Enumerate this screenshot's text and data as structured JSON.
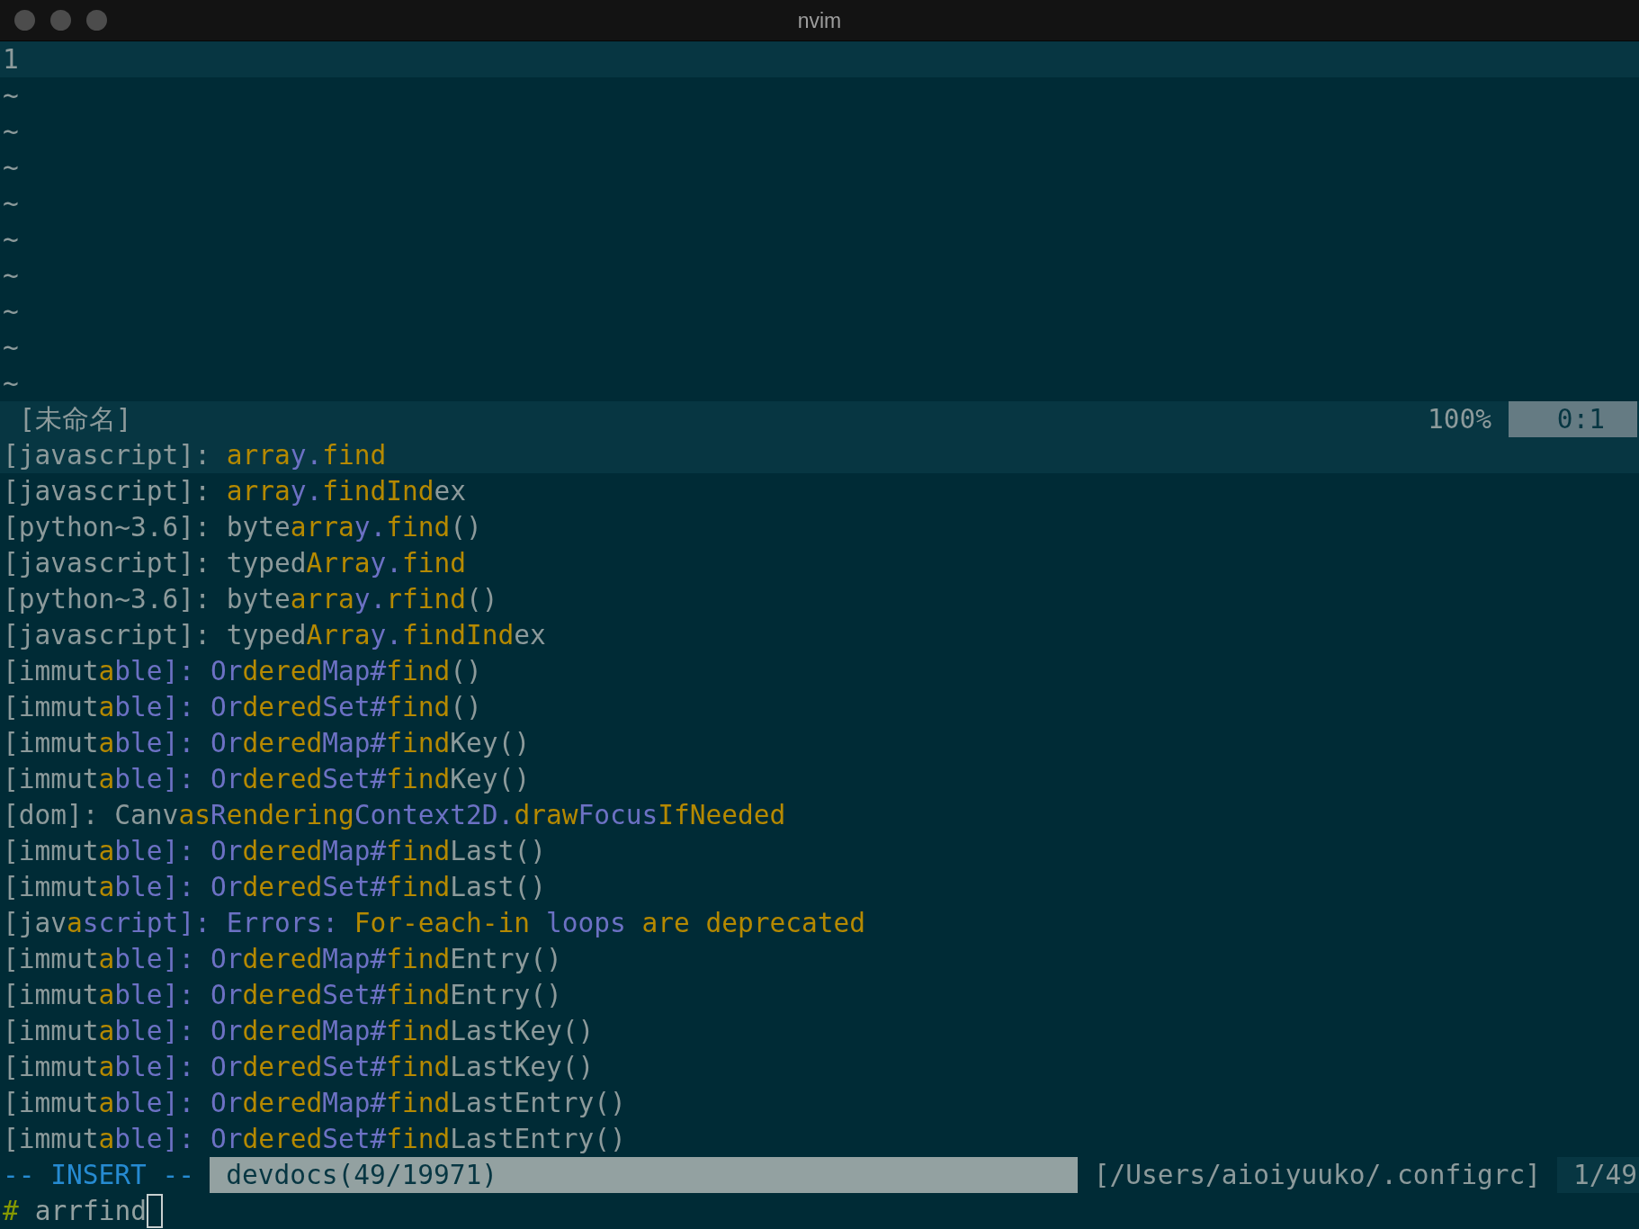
{
  "window": {
    "title": "nvim"
  },
  "editor": {
    "lines": [
      {
        "number": "1",
        "current": true
      }
    ],
    "filler_lines": [
      "~",
      "~",
      "~",
      "~",
      "~",
      "~",
      "~",
      "~",
      "~"
    ]
  },
  "status_line": {
    "file_name": "[未命名]",
    "percent": "100%",
    "position": "0:1"
  },
  "results": [
    {
      "selected": true,
      "segments": [
        {
          "text": "[javascript]: ",
          "kind": "plain"
        },
        {
          "text": "arra",
          "kind": "match"
        },
        {
          "text": "y.",
          "kind": "accent"
        },
        {
          "text": "find",
          "kind": "match"
        }
      ]
    },
    {
      "selected": false,
      "segments": [
        {
          "text": "[javascript]: ",
          "kind": "plain"
        },
        {
          "text": "arra",
          "kind": "match"
        },
        {
          "text": "y.",
          "kind": "accent"
        },
        {
          "text": "findInd",
          "kind": "match"
        },
        {
          "text": "ex",
          "kind": "plain"
        }
      ]
    },
    {
      "selected": false,
      "segments": [
        {
          "text": "[python~3.6]: byte",
          "kind": "plain"
        },
        {
          "text": "arra",
          "kind": "match"
        },
        {
          "text": "y.",
          "kind": "accent"
        },
        {
          "text": "find",
          "kind": "match"
        },
        {
          "text": "()",
          "kind": "plain"
        }
      ]
    },
    {
      "selected": false,
      "segments": [
        {
          "text": "[javascript]: typed",
          "kind": "plain"
        },
        {
          "text": "Arra",
          "kind": "match"
        },
        {
          "text": "y.",
          "kind": "accent"
        },
        {
          "text": "find",
          "kind": "match"
        }
      ]
    },
    {
      "selected": false,
      "segments": [
        {
          "text": "[python~3.6]: byte",
          "kind": "plain"
        },
        {
          "text": "arra",
          "kind": "match"
        },
        {
          "text": "y.",
          "kind": "accent"
        },
        {
          "text": "rfind",
          "kind": "match"
        },
        {
          "text": "()",
          "kind": "plain"
        }
      ]
    },
    {
      "selected": false,
      "segments": [
        {
          "text": "[javascript]: typed",
          "kind": "plain"
        },
        {
          "text": "Arra",
          "kind": "match"
        },
        {
          "text": "y.",
          "kind": "accent"
        },
        {
          "text": "findInd",
          "kind": "match"
        },
        {
          "text": "ex",
          "kind": "plain"
        }
      ]
    },
    {
      "selected": false,
      "segments": [
        {
          "text": "[immut",
          "kind": "plain"
        },
        {
          "text": "a",
          "kind": "match"
        },
        {
          "text": "ble]: Or",
          "kind": "accent"
        },
        {
          "text": "dered",
          "kind": "match"
        },
        {
          "text": "Map#",
          "kind": "accent"
        },
        {
          "text": "find",
          "kind": "match"
        },
        {
          "text": "()",
          "kind": "plain"
        }
      ]
    },
    {
      "selected": false,
      "segments": [
        {
          "text": "[immut",
          "kind": "plain"
        },
        {
          "text": "a",
          "kind": "match"
        },
        {
          "text": "ble]: Or",
          "kind": "accent"
        },
        {
          "text": "dered",
          "kind": "match"
        },
        {
          "text": "Set#",
          "kind": "accent"
        },
        {
          "text": "find",
          "kind": "match"
        },
        {
          "text": "()",
          "kind": "plain"
        }
      ]
    },
    {
      "selected": false,
      "segments": [
        {
          "text": "[immut",
          "kind": "plain"
        },
        {
          "text": "a",
          "kind": "match"
        },
        {
          "text": "ble]: Or",
          "kind": "accent"
        },
        {
          "text": "dered",
          "kind": "match"
        },
        {
          "text": "Map#",
          "kind": "accent"
        },
        {
          "text": "find",
          "kind": "match"
        },
        {
          "text": "Key()",
          "kind": "plain"
        }
      ]
    },
    {
      "selected": false,
      "segments": [
        {
          "text": "[immut",
          "kind": "plain"
        },
        {
          "text": "a",
          "kind": "match"
        },
        {
          "text": "ble]: Or",
          "kind": "accent"
        },
        {
          "text": "dered",
          "kind": "match"
        },
        {
          "text": "Set#",
          "kind": "accent"
        },
        {
          "text": "find",
          "kind": "match"
        },
        {
          "text": "Key()",
          "kind": "plain"
        }
      ]
    },
    {
      "selected": false,
      "segments": [
        {
          "text": "[dom]: Canv",
          "kind": "plain"
        },
        {
          "text": "as",
          "kind": "match"
        },
        {
          "text": "R",
          "kind": "accent"
        },
        {
          "text": "endering",
          "kind": "match"
        },
        {
          "text": "Context2D.",
          "kind": "accent"
        },
        {
          "text": "draw",
          "kind": "match"
        },
        {
          "text": "Focus",
          "kind": "accent"
        },
        {
          "text": "IfNeeded",
          "kind": "match"
        }
      ]
    },
    {
      "selected": false,
      "segments": [
        {
          "text": "[immut",
          "kind": "plain"
        },
        {
          "text": "a",
          "kind": "match"
        },
        {
          "text": "ble]: Or",
          "kind": "accent"
        },
        {
          "text": "dered",
          "kind": "match"
        },
        {
          "text": "Map#",
          "kind": "accent"
        },
        {
          "text": "find",
          "kind": "match"
        },
        {
          "text": "Last()",
          "kind": "plain"
        }
      ]
    },
    {
      "selected": false,
      "segments": [
        {
          "text": "[immut",
          "kind": "plain"
        },
        {
          "text": "a",
          "kind": "match"
        },
        {
          "text": "ble]: Or",
          "kind": "accent"
        },
        {
          "text": "dered",
          "kind": "match"
        },
        {
          "text": "Set#",
          "kind": "accent"
        },
        {
          "text": "find",
          "kind": "match"
        },
        {
          "text": "Last()",
          "kind": "plain"
        }
      ]
    },
    {
      "selected": false,
      "segments": [
        {
          "text": "[jav",
          "kind": "plain"
        },
        {
          "text": "a",
          "kind": "match"
        },
        {
          "text": "script]: Errors: ",
          "kind": "accent"
        },
        {
          "text": "For-each-in",
          "kind": "match"
        },
        {
          "text": " loops ",
          "kind": "accent"
        },
        {
          "text": "are deprecated",
          "kind": "match"
        }
      ]
    },
    {
      "selected": false,
      "segments": [
        {
          "text": "[immut",
          "kind": "plain"
        },
        {
          "text": "a",
          "kind": "match"
        },
        {
          "text": "ble]: Or",
          "kind": "accent"
        },
        {
          "text": "dered",
          "kind": "match"
        },
        {
          "text": "Map#",
          "kind": "accent"
        },
        {
          "text": "find",
          "kind": "match"
        },
        {
          "text": "Entry()",
          "kind": "plain"
        }
      ]
    },
    {
      "selected": false,
      "segments": [
        {
          "text": "[immut",
          "kind": "plain"
        },
        {
          "text": "a",
          "kind": "match"
        },
        {
          "text": "ble]: Or",
          "kind": "accent"
        },
        {
          "text": "dered",
          "kind": "match"
        },
        {
          "text": "Set#",
          "kind": "accent"
        },
        {
          "text": "find",
          "kind": "match"
        },
        {
          "text": "Entry()",
          "kind": "plain"
        }
      ]
    },
    {
      "selected": false,
      "segments": [
        {
          "text": "[immut",
          "kind": "plain"
        },
        {
          "text": "a",
          "kind": "match"
        },
        {
          "text": "ble]: Or",
          "kind": "accent"
        },
        {
          "text": "dered",
          "kind": "match"
        },
        {
          "text": "Map#",
          "kind": "accent"
        },
        {
          "text": "find",
          "kind": "match"
        },
        {
          "text": "LastKey()",
          "kind": "plain"
        }
      ]
    },
    {
      "selected": false,
      "segments": [
        {
          "text": "[immut",
          "kind": "plain"
        },
        {
          "text": "a",
          "kind": "match"
        },
        {
          "text": "ble]: Or",
          "kind": "accent"
        },
        {
          "text": "dered",
          "kind": "match"
        },
        {
          "text": "Set#",
          "kind": "accent"
        },
        {
          "text": "find",
          "kind": "match"
        },
        {
          "text": "LastKey()",
          "kind": "plain"
        }
      ]
    },
    {
      "selected": false,
      "segments": [
        {
          "text": "[immut",
          "kind": "plain"
        },
        {
          "text": "a",
          "kind": "match"
        },
        {
          "text": "ble]: Or",
          "kind": "accent"
        },
        {
          "text": "dered",
          "kind": "match"
        },
        {
          "text": "Map#",
          "kind": "accent"
        },
        {
          "text": "find",
          "kind": "match"
        },
        {
          "text": "LastEntry()",
          "kind": "plain"
        }
      ]
    },
    {
      "selected": false,
      "segments": [
        {
          "text": "[immut",
          "kind": "plain"
        },
        {
          "text": "a",
          "kind": "match"
        },
        {
          "text": "ble]: Or",
          "kind": "accent"
        },
        {
          "text": "dered",
          "kind": "match"
        },
        {
          "text": "Set#",
          "kind": "accent"
        },
        {
          "text": "find",
          "kind": "match"
        },
        {
          "text": "LastEntry()",
          "kind": "plain"
        }
      ]
    }
  ],
  "bottom_status": {
    "mode": "-- INSERT --",
    "source": "devdocs(49/19971)",
    "path": "[/Users/aioiyuuko/.configrc]",
    "count": "1/49"
  },
  "command_line": {
    "prompt": "#",
    "value": "arrfind"
  }
}
